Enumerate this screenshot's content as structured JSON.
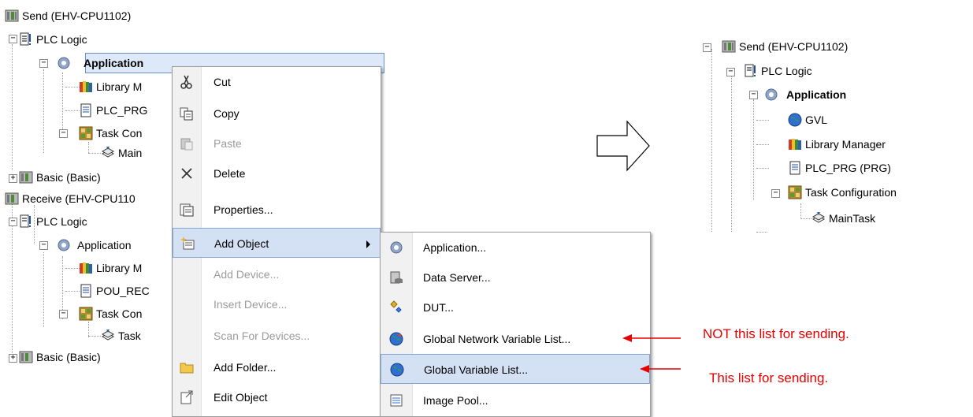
{
  "left_tree": {
    "send_device": "Send (EHV-CPU1102)",
    "send_plc_logic": "PLC Logic",
    "send_application": "Application",
    "send_library": "Library M",
    "send_plc_prg": "PLC_PRG",
    "send_task_config": "Task Con",
    "send_maintask": "Main",
    "basic1": "Basic (Basic)",
    "receive_device": "Receive (EHV-CPU110",
    "recv_plc_logic": "PLC Logic",
    "recv_application": "Application",
    "recv_library": "Library M",
    "recv_pou": "POU_REC",
    "recv_task_config": "Task Con",
    "recv_task": "Task",
    "basic2": "Basic (Basic)"
  },
  "context_menu": {
    "cut": "Cut",
    "copy": "Copy",
    "paste": "Paste",
    "delete": "Delete",
    "properties": "Properties...",
    "add_object": "Add Object",
    "add_device": "Add Device...",
    "insert_device": "Insert Device...",
    "scan_devices": "Scan For Devices...",
    "add_folder": "Add Folder...",
    "edit_object": "Edit Object"
  },
  "submenu": {
    "application": "Application...",
    "data_server": "Data Server...",
    "dut": "DUT...",
    "gnvl": "Global Network Variable List...",
    "gvl": "Global Variable List...",
    "image_pool": "Image Pool..."
  },
  "annotations": {
    "not_this": "NOT this list for sending.",
    "this": "This list for sending."
  },
  "right_tree": {
    "device": "Send (EHV-CPU1102)",
    "plc_logic": "PLC Logic",
    "application": "Application",
    "gvl": "GVL",
    "library": "Library Manager",
    "plc_prg": "PLC_PRG (PRG)",
    "task_config": "Task Configuration",
    "maintask": "MainTask"
  },
  "colors": {
    "annotation_red": "#e60000",
    "highlight": "#d4e1f5"
  }
}
